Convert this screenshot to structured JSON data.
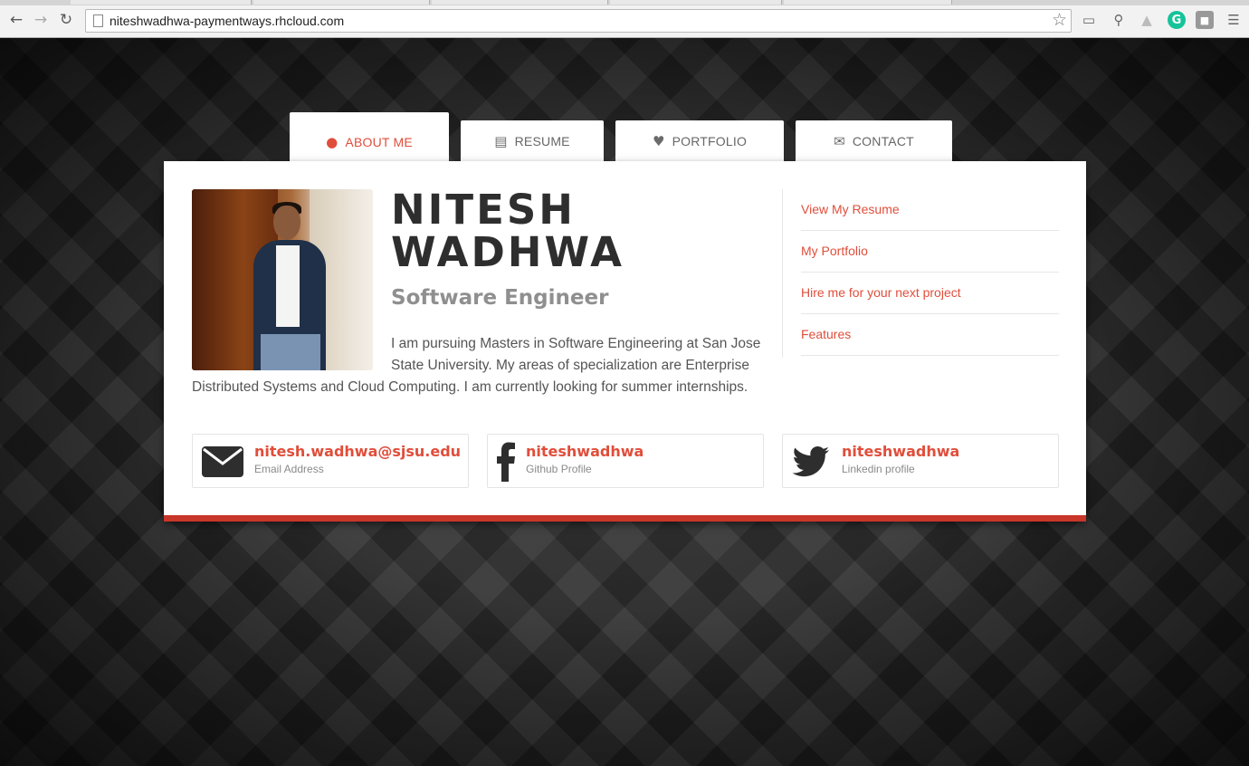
{
  "browser": {
    "url": "niteshwadhwa-paymentways.rhcloud.com",
    "back_icon": "arrow-left-icon",
    "forward_icon": "arrow-right-icon",
    "reload_icon": "reload-icon"
  },
  "tabs": [
    {
      "label": "About me",
      "icon": "user-icon"
    },
    {
      "label": "Resume",
      "icon": "file-icon"
    },
    {
      "label": "Portfolio",
      "icon": "heart-icon"
    },
    {
      "label": "Contact",
      "icon": "envelope-icon"
    }
  ],
  "profile": {
    "name_line1": "NITESH",
    "name_line2": "WADHWA",
    "role": "Software Engineer",
    "bio": "I am pursuing Masters in Software Engineering at San Jose State University. My areas of specialization are Enterprise Distributed Systems and Cloud Computing. I am currently looking for summer internships."
  },
  "sidebar": {
    "links": [
      {
        "label": "View My Resume"
      },
      {
        "label": "My Portfolio"
      },
      {
        "label": "Hire me for your next project"
      },
      {
        "label": "Features"
      }
    ]
  },
  "contacts": [
    {
      "title": "nitesh.wadhwa@sjsu.edu",
      "subtitle": "Email Address",
      "icon": "envelope-icon"
    },
    {
      "title": "niteshwadhwa",
      "subtitle": "Github Profile",
      "icon": "facebook-icon"
    },
    {
      "title": "niteshwadhwa",
      "subtitle": "Linkedin profile",
      "icon": "twitter-icon"
    }
  ],
  "colors": {
    "accent": "#e04e3b",
    "card_border": "#c9362a",
    "heading": "#2e2e2e",
    "subheading": "#8f8f8f"
  }
}
